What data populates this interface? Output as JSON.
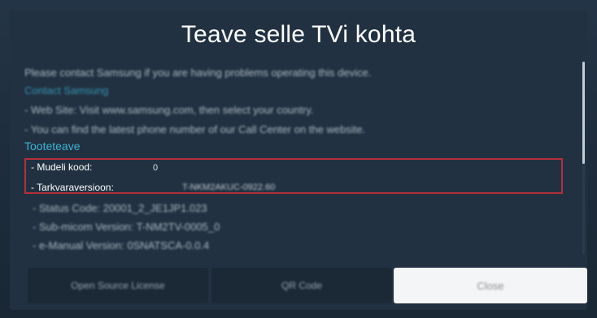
{
  "dialog": {
    "title": "Teave selle TVi kohta"
  },
  "content": {
    "intro": "Please contact Samsung if you are having problems operating this device.",
    "contact_header": "Contact Samsung",
    "web_site": "- Web Site: Visit www.samsung.com, then select your country.",
    "phone": "- You can find the latest phone number of our Call Center on the website.",
    "section_header": "Tooteteave",
    "model_code_label": "- Mudeli kood:",
    "model_code_value": "0",
    "software_label": "- Tarkvaraversioon:",
    "software_value": "T-NKM2AKUC-0922.60",
    "status_code": "- Status Code: 20001_2_JE1JP1.023",
    "micom_version": "- Sub-micom Version: T-NM2TV-0005_0",
    "manual_version": "- e-Manual Version: 0SNATSCA-0.0.4"
  },
  "buttons": {
    "open_source": "Open Source License",
    "qr_code": "QR Code",
    "close": "Close"
  },
  "colors": {
    "highlight": "#b4303a",
    "section_header": "#3db5d6"
  },
  "scrollbar": {
    "visible_fraction": 0.53,
    "scroll_position": 0
  }
}
